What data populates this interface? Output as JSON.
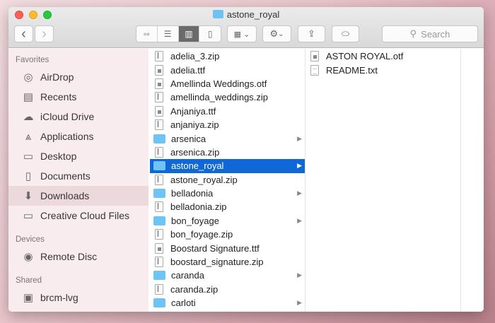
{
  "window": {
    "title": "astone_royal"
  },
  "toolbar": {
    "back": "‹",
    "forward": "›",
    "views": [
      "icon-view",
      "list-view",
      "column-view",
      "coverflow-view"
    ],
    "active_view": "column-view",
    "search_placeholder": "Search"
  },
  "colors": {
    "selection": "#0f68d6",
    "folder": "#6ec4f3",
    "close": "#fc5f57",
    "minimize": "#fdbc2e",
    "zoom": "#28c840"
  },
  "sidebar": {
    "favorites_label": "Favorites",
    "favorites": [
      {
        "label": "AirDrop",
        "icon": "airdrop"
      },
      {
        "label": "Recents",
        "icon": "recents"
      },
      {
        "label": "iCloud Drive",
        "icon": "cloud"
      },
      {
        "label": "Applications",
        "icon": "applications"
      },
      {
        "label": "Desktop",
        "icon": "desktop"
      },
      {
        "label": "Documents",
        "icon": "documents"
      },
      {
        "label": "Downloads",
        "icon": "downloads",
        "selected": true
      },
      {
        "label": "Creative Cloud Files",
        "icon": "folder"
      }
    ],
    "devices_label": "Devices",
    "devices": [
      {
        "label": "Remote Disc",
        "icon": "disc"
      }
    ],
    "shared_label": "Shared",
    "shared": [
      {
        "label": "brcm-lvg",
        "icon": "computer"
      }
    ]
  },
  "columns": [
    [
      {
        "name": "adelia_3.zip",
        "type": "zip"
      },
      {
        "name": "adelia.ttf",
        "type": "font"
      },
      {
        "name": "Amellinda Weddings.otf",
        "type": "font"
      },
      {
        "name": "amellinda_weddings.zip",
        "type": "zip"
      },
      {
        "name": "Anjaniya.ttf",
        "type": "font"
      },
      {
        "name": "anjaniya.zip",
        "type": "zip"
      },
      {
        "name": "arsenica",
        "type": "folder"
      },
      {
        "name": "arsenica.zip",
        "type": "zip"
      },
      {
        "name": "astone_royal",
        "type": "folder",
        "selected": true
      },
      {
        "name": "astone_royal.zip",
        "type": "zip"
      },
      {
        "name": "belladonia",
        "type": "folder"
      },
      {
        "name": "belladonia.zip",
        "type": "zip"
      },
      {
        "name": "bon_foyage",
        "type": "folder"
      },
      {
        "name": "bon_foyage.zip",
        "type": "zip"
      },
      {
        "name": "Boostard Signature.ttf",
        "type": "font"
      },
      {
        "name": "boostard_signature.zip",
        "type": "zip"
      },
      {
        "name": "caranda",
        "type": "folder"
      },
      {
        "name": "caranda.zip",
        "type": "zip"
      },
      {
        "name": "carloti",
        "type": "folder"
      }
    ],
    [
      {
        "name": "ASTON ROYAL.otf",
        "type": "font"
      },
      {
        "name": "README.txt",
        "type": "txt"
      }
    ]
  ]
}
